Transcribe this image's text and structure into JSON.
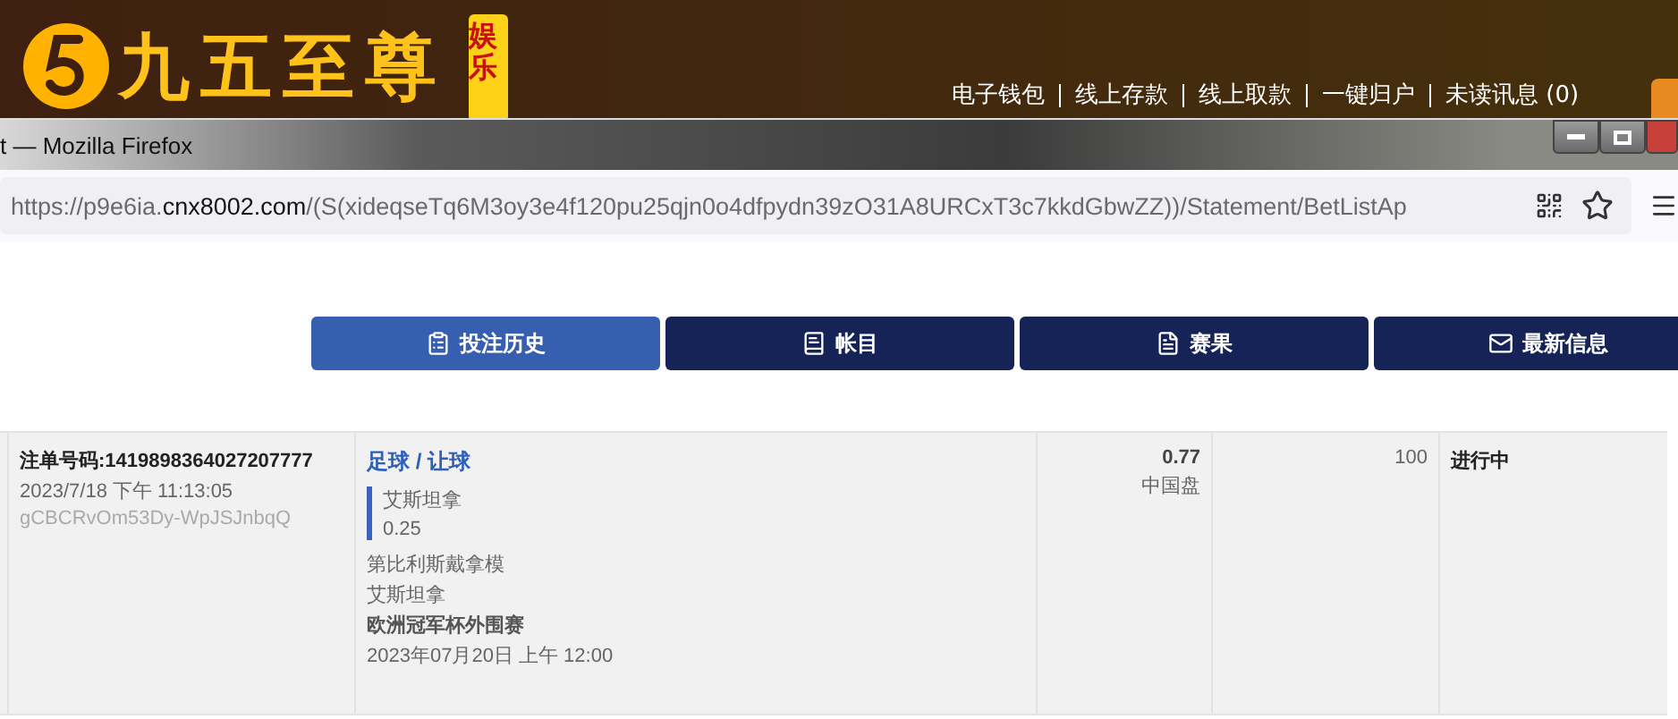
{
  "site": {
    "brand": "九五至尊",
    "badge": "娱乐",
    "links": [
      "电子钱包",
      "线上存款",
      "线上取款",
      "一键归户",
      "未读讯息 (0)"
    ]
  },
  "browser": {
    "title": "t — Mozilla Firefox",
    "url": {
      "scheme": "https://p9e6ia.",
      "domain": "cnx8002.com",
      "path": "/(S(xideqseTq6M3oy3e4f120pu25qjn0o4dfpydn39zO31A8URCxT3c7kkdGbwZZ))/Statement/BetListAp"
    }
  },
  "tabs": [
    {
      "label": "投注历史",
      "kind": "history",
      "selected": true
    },
    {
      "label": "帐目",
      "kind": "ledger",
      "selected": false
    },
    {
      "label": "赛果",
      "kind": "results",
      "selected": false
    },
    {
      "label": "最新信息",
      "kind": "messages",
      "selected": false
    }
  ],
  "bets": [
    {
      "order_no": "注单号码:1419898364027207777",
      "placed": "2023/7/18 下午 11:13:05",
      "code": "gCBCRvOm53Dy-WpJSJnbqQ",
      "market": "足球 / 让球",
      "selection": "艾斯坦拿",
      "handicap": "0.25",
      "home": "第比利斯戴拿模",
      "away": "艾斯坦拿",
      "league": "欧洲冠军杯外围赛",
      "kickoff": "2023年07月20日 上午 12:00",
      "odds": "0.77",
      "odds_type": "中国盘",
      "stake": "100",
      "status": "进行中"
    }
  ]
}
